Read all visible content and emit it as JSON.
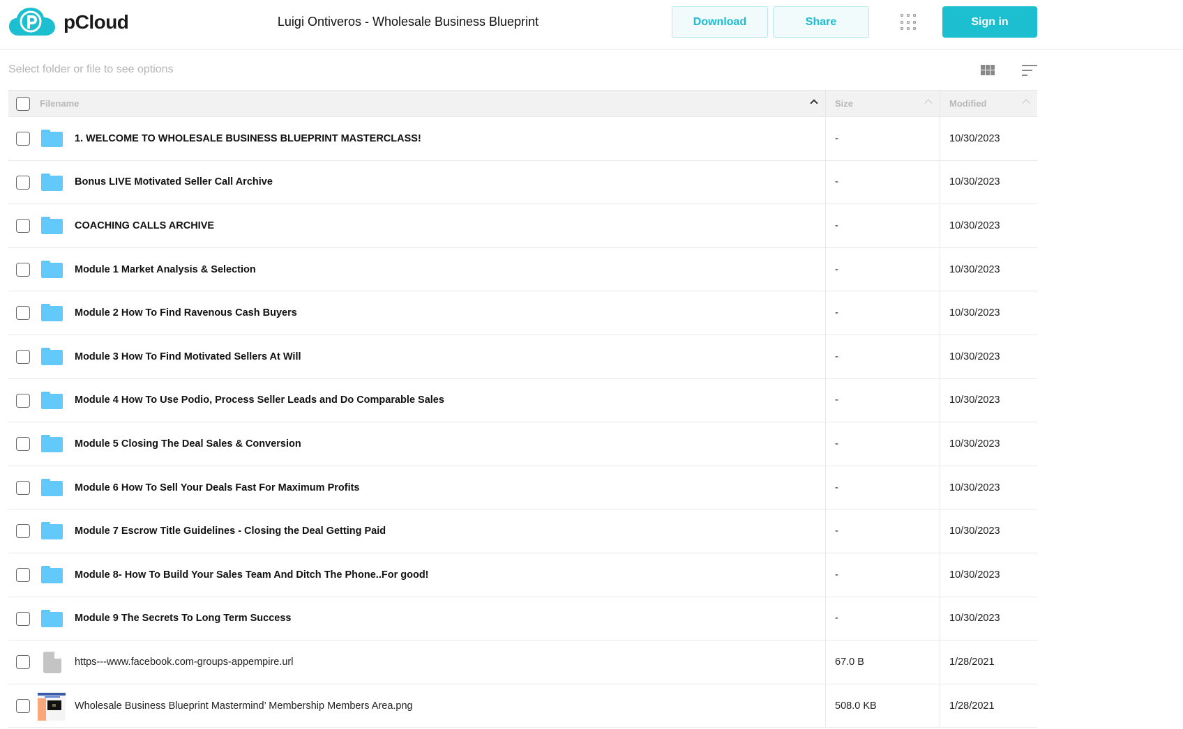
{
  "header": {
    "brand": "pCloud",
    "title": "Luigi Ontiveros - Wholesale Business Blueprint",
    "download_label": "Download",
    "share_label": "Share",
    "signin_label": "Sign in",
    "accent_color": "#1bbfd0"
  },
  "toolbar": {
    "hint": "Select folder or file to see options"
  },
  "table": {
    "columns": {
      "filename": "Filename",
      "size": "Size",
      "modified": "Modified"
    },
    "rows": [
      {
        "type": "folder",
        "name": "1. WELCOME TO WHOLESALE BUSINESS BLUEPRINT MASTERCLASS!",
        "size": "-",
        "modified": "10/30/2023"
      },
      {
        "type": "folder",
        "name": "Bonus LIVE Motivated Seller Call Archive",
        "size": "-",
        "modified": "10/30/2023"
      },
      {
        "type": "folder",
        "name": "COACHING CALLS ARCHIVE",
        "size": "-",
        "modified": "10/30/2023"
      },
      {
        "type": "folder",
        "name": "Module 1 Market Analysis & Selection",
        "size": "-",
        "modified": "10/30/2023"
      },
      {
        "type": "folder",
        "name": "Module 2 How To Find Ravenous Cash Buyers",
        "size": "-",
        "modified": "10/30/2023"
      },
      {
        "type": "folder",
        "name": "Module 3 How To Find Motivated Sellers At Will",
        "size": "-",
        "modified": "10/30/2023"
      },
      {
        "type": "folder",
        "name": "Module 4 How To Use Podio, Process Seller Leads and Do Comparable Sales",
        "size": "-",
        "modified": "10/30/2023"
      },
      {
        "type": "folder",
        "name": "Module 5 Closing The Deal Sales & Conversion",
        "size": "-",
        "modified": "10/30/2023"
      },
      {
        "type": "folder",
        "name": "Module 6 How To Sell Your Deals Fast For Maximum Profits",
        "size": "-",
        "modified": "10/30/2023"
      },
      {
        "type": "folder",
        "name": "Module 7 Escrow Title Guidelines - Closing the Deal Getting Paid",
        "size": "-",
        "modified": "10/30/2023"
      },
      {
        "type": "folder",
        "name": "Module 8- How To Build Your Sales Team And Ditch The Phone..For good!",
        "size": "-",
        "modified": "10/30/2023"
      },
      {
        "type": "folder",
        "name": "Module 9 The Secrets To Long Term Success",
        "size": "-",
        "modified": "10/30/2023"
      },
      {
        "type": "file",
        "name": "https---www.facebook.com-groups-appempire.url",
        "size": "67.0 B",
        "modified": "1/28/2021"
      },
      {
        "type": "image",
        "name": "Wholesale Business Blueprint Mastermind’ Membership Members Area.png",
        "size": "508.0 KB",
        "modified": "1/28/2021"
      }
    ]
  }
}
